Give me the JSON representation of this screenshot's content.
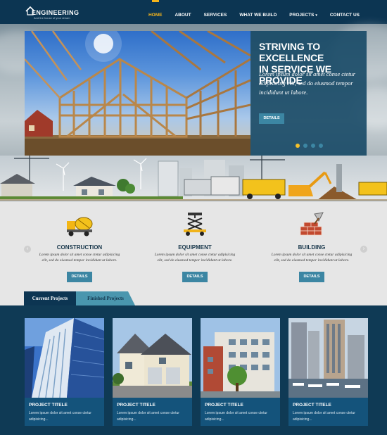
{
  "brand": {
    "name": "ENGINEERING",
    "tagline": "And the house of your dream"
  },
  "nav": {
    "items": [
      {
        "label": "HOME",
        "active": true
      },
      {
        "label": "ABOUT"
      },
      {
        "label": "SERVICES"
      },
      {
        "label": "WHAT WE BUILD"
      },
      {
        "label": "PROJECTS",
        "has_dropdown": true
      },
      {
        "label": "CONTACT US"
      }
    ]
  },
  "hero": {
    "title_line1": "STRIVING TO EXCELLENCE",
    "title_line2": "IN SERVICE WE PROVIDE",
    "text": "Lorem ipsum dolor sit amet conse ctetur adipisicing elit, sed do eiusmod tempor incididunt ut labore.",
    "button": "DETAILS",
    "slides": 4,
    "active_slide": 1
  },
  "services": {
    "prev_icon": "chevron-left-icon",
    "next_icon": "chevron-right-icon",
    "items": [
      {
        "title": "CONSTRUCTION",
        "icon": "concrete-mixer-icon",
        "text": "Lorem ipsum dolor sit amet conse ctetur adipisicing elit, sed do eiusmod tempor incididunt ut labore.",
        "button": "DETAILS"
      },
      {
        "title": "EQUIPMENT",
        "icon": "scissor-lift-icon",
        "text": "Lorem ipsum dolor sit amet conse ctetur adipisicing elit, sed do eiusmod tempor incididunt ut labore.",
        "button": "DETAILS"
      },
      {
        "title": "BUILDING",
        "icon": "brick-wall-icon",
        "text": "Lorem ipsum dolor sit amet conse ctetur adipisicing elit, sed do eiusmod tempor incididunt ut labore.",
        "button": "DETAILS"
      }
    ]
  },
  "tabs": {
    "current": "Current Projects",
    "finished": "Finished Projects"
  },
  "projects": [
    {
      "title": "PROJECT TITELE",
      "text": "Lorem ipsum dolor sit amet conse ctetur adipisicing..."
    },
    {
      "title": "PROJECT TITELE",
      "text": "Lorem ipsum dolor sit amet conse ctetur adipisicing..."
    },
    {
      "title": "PROJECT TITELE",
      "text": "Lorem ipsum dolor sit amet conse ctetur adipisicing..."
    },
    {
      "title": "PROJECT TITELE",
      "text": "Lorem ipsum dolor sit amet conse ctetur adipisicing..."
    }
  ],
  "colors": {
    "header": "#0c3552",
    "accent": "#f5b41b",
    "button": "#3c86a3",
    "panel": "#124663",
    "services_bg": "#e6e6e6",
    "card": "#14537b"
  }
}
